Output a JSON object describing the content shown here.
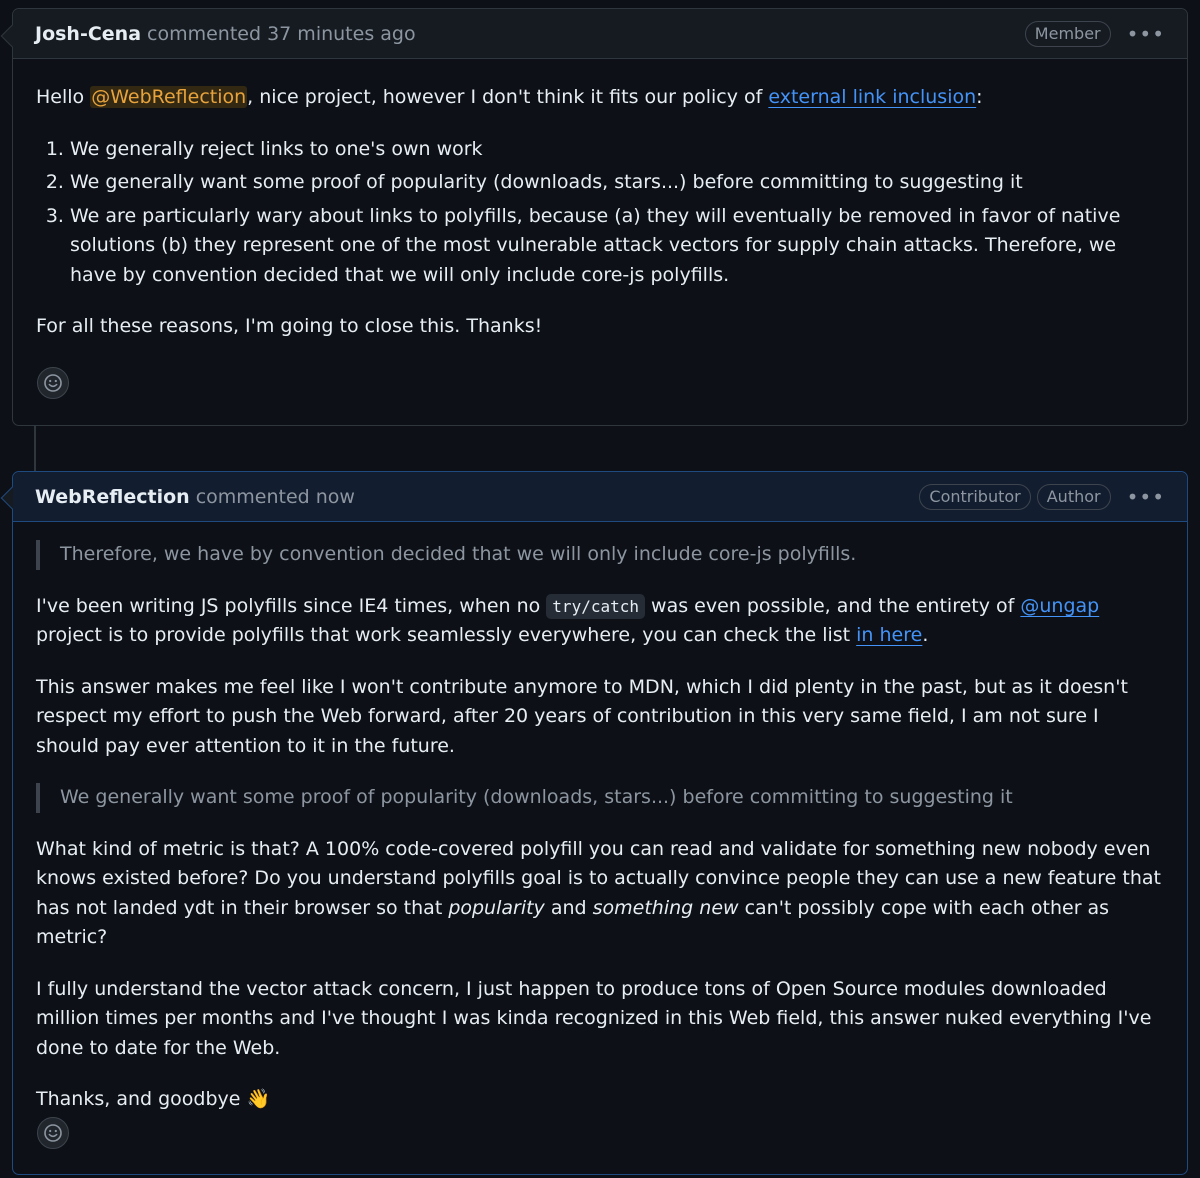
{
  "comments": [
    {
      "author": "Josh-Cena",
      "meta": "commented 37 minutes ago",
      "badges": [
        "Member"
      ],
      "greeting": "Hello ",
      "mention": "@WebReflection",
      "intro_mid": ", nice project, however I don't think it fits our policy of ",
      "link_text": "external link inclusion",
      "intro_end": ":",
      "list": [
        "We generally reject links to one's own work",
        "We generally want some proof of popularity (downloads, stars...) before committing to suggesting it",
        "We are particularly wary about links to polyfills, because (a) they will eventually be removed in favor of native solutions (b) they represent one of the most vulnerable attack vectors for supply chain attacks. Therefore, we have by convention decided that we will only include core-js polyfills."
      ],
      "closing": "For all these reasons, I'm going to close this. Thanks!"
    },
    {
      "author": "WebReflection",
      "meta": "commented now",
      "badges": [
        "Contributor",
        "Author"
      ],
      "quote1": "Therefore, we have by convention decided that we will only include core-js polyfills.",
      "p1_a": "I've been writing JS polyfills since IE4 times, when no ",
      "p1_code": "try/catch",
      "p1_b": " was even possible, and the entirety of ",
      "p1_link1": "@ungap",
      "p1_c": " project is to provide polyfills that work seamlessly everywhere, you can check the list ",
      "p1_link2": "in here",
      "p1_d": ".",
      "p2": "This answer makes me feel like I won't contribute anymore to MDN, which I did plenty in the past, but as it doesn't respect my effort to push the Web forward, after 20 years of contribution in this very same field, I am not sure I should pay ever attention to it in the future.",
      "quote2": "We generally want some proof of popularity (downloads, stars...) before committing to suggesting it",
      "p3_a": "What kind of metric is that? A 100% code-covered polyfill you can read and validate for something new nobody even knows existed before? Do you understand polyfills goal is to actually convince people they can use a new feature that has not landed ydt in their browser so that ",
      "p3_em1": "popularity",
      "p3_b": " and ",
      "p3_em2": "something new",
      "p3_c": " can't possibly cope with each other as metric?",
      "p4": "I fully understand the vector attack concern, I just happen to produce tons of Open Source modules downloaded million times per months and I've thought I was kinda recognized in this Web field, this answer nuked everything I've done to date for the Web.",
      "p5": "Thanks, and goodbye 👋"
    }
  ],
  "icons": {
    "kebab": "kebab-horizontal-icon",
    "reaction": "smiley-icon"
  },
  "colors": {
    "background": "#0d1117",
    "header": "#161b22",
    "link": "#4493f8",
    "mention": "#e8a33c",
    "muted": "#8d96a0"
  }
}
